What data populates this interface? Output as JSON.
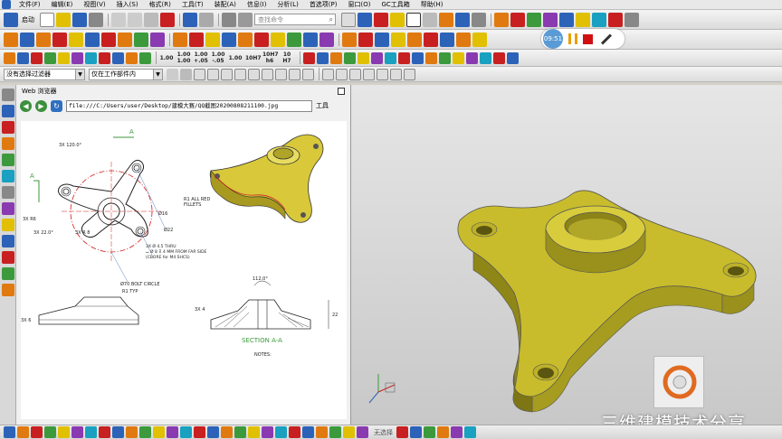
{
  "menubar": {
    "items": [
      "文件(F)",
      "编辑(E)",
      "视图(V)",
      "插入(S)",
      "格式(R)",
      "工具(T)",
      "装配(A)",
      "信息(I)",
      "分析(L)",
      "首选项(P)",
      "窗口(O)",
      "GC工具箱",
      "帮助(H)"
    ]
  },
  "toolbar": {
    "start_label": "启动",
    "search_placeholder": "查找命令",
    "filter_select": "没有选择过滤器",
    "scope_select": "仅在工作部件内",
    "precision_labels": [
      "1.00",
      "1.00\n1.00",
      "1.00\n+.05",
      "1.00\n-.05",
      "1.00",
      "10H7",
      "10H7\nh6",
      "10\nH7"
    ],
    "colors": {
      "orange": "#e07a10",
      "blue": "#2c63b8",
      "green": "#3c9a3c",
      "yellow": "#e0c000",
      "purple": "#8a3ab0",
      "red": "#c82020",
      "cyan": "#1aa0c0"
    }
  },
  "recorder": {
    "time": "09:51"
  },
  "web_panel": {
    "title": "Web 浏览器",
    "address": "file:///C:/Users/user/Desktop/建模大赛/QQ截图20200808211100.jpg",
    "tools_label": "工具"
  },
  "drawing": {
    "annotations": {
      "angle_120": "3X 120.0°",
      "label_a": "A",
      "r6": "3X R6",
      "r16": "Ø16",
      "r22": "Ø22",
      "angle_22": "3X 22.0°",
      "r8": "3X R 8",
      "thru": "3X Ø 4.5 THRU",
      "cbore": "⌴ Ø 8 ⊽ 4 MM FROM FAR SIDE",
      "cbore_note": "(CBORE for M4 SHCS)",
      "bolt_circle": "Ø70 BOLT CIRCLE",
      "fillets": "R1 ALL RED\nFILLETS",
      "r1typ": "R1 TYP",
      "angle_112": "112.0°",
      "dim_3x4": "3X 4",
      "dim_22": "22",
      "dim_3x6": "3X 6",
      "section": "SECTION A-A",
      "notes": "NOTES:"
    }
  },
  "watermark": "三维建模技术分享",
  "statusbar": {
    "items": [
      "无选择"
    ]
  }
}
